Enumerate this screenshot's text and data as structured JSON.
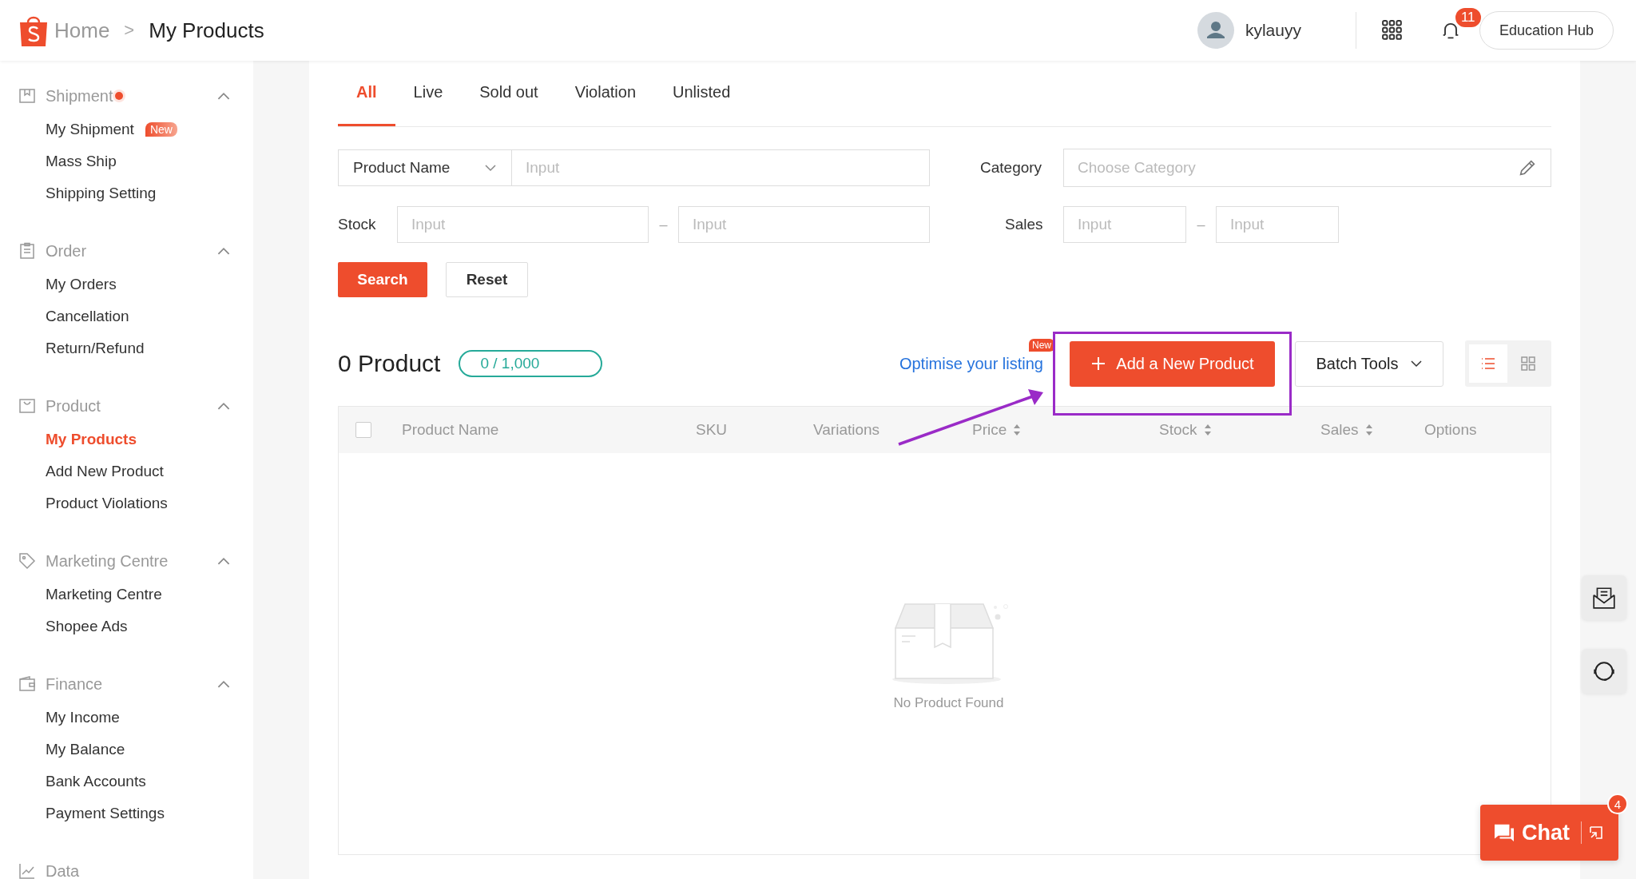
{
  "header": {
    "breadcrumb": [
      {
        "label": "Home"
      }
    ],
    "separator": ">",
    "current": "My Products",
    "user": "kylauyy",
    "notification_count": "11",
    "button": "Education Hub"
  },
  "sidebar": {
    "sections": [
      {
        "kind": "shipment",
        "title": "Shipment",
        "dot": true,
        "expanded": true,
        "items": [
          {
            "label": "My Shipment",
            "selected": false,
            "badge": "New"
          },
          {
            "label": "Mass Ship",
            "selected": false
          },
          {
            "label": "Shipping Setting",
            "selected": false
          }
        ]
      },
      {
        "kind": "order",
        "title": "Order",
        "expanded": true,
        "items": [
          {
            "label": "My Orders",
            "selected": false
          },
          {
            "label": "Cancellation",
            "selected": false
          },
          {
            "label": "Return/Refund",
            "selected": false
          }
        ]
      },
      {
        "kind": "product",
        "title": "Product",
        "expanded": true,
        "items": [
          {
            "label": "My Products",
            "selected": true
          },
          {
            "label": "Add New Product",
            "selected": false
          },
          {
            "label": "Product Violations",
            "selected": false
          }
        ]
      },
      {
        "kind": "marketing",
        "title": "Marketing Centre",
        "expanded": true,
        "items": [
          {
            "label": "Marketing Centre",
            "selected": false
          },
          {
            "label": "Shopee Ads",
            "selected": false
          }
        ]
      },
      {
        "kind": "finance",
        "title": "Finance",
        "expanded": true,
        "items": [
          {
            "label": "My Income",
            "selected": false
          },
          {
            "label": "My Balance",
            "selected": false
          },
          {
            "label": "Bank Accounts",
            "selected": false
          },
          {
            "label": "Payment Settings",
            "selected": false
          }
        ]
      },
      {
        "kind": "data",
        "title": "Data"
      }
    ]
  },
  "tabs": [
    {
      "label": "All",
      "selected": true
    },
    {
      "label": "Live",
      "selected": false
    },
    {
      "label": "Sold out",
      "selected": false
    },
    {
      "label": "Violation",
      "selected": false
    },
    {
      "label": "Unlisted",
      "selected": false
    }
  ],
  "filters": {
    "field_select": "Product Name",
    "field_input": {
      "placeholder": "Input"
    },
    "category": {
      "label": "Category",
      "placeholder": "Choose Category"
    },
    "stock": {
      "label": "Stock",
      "min": {
        "placeholder": "Input"
      },
      "separator": "–",
      "max": {
        "placeholder": "Input"
      }
    },
    "sales": {
      "label": "Sales",
      "min": {
        "placeholder": "Input"
      },
      "separator": "–",
      "max": {
        "placeholder": "Input"
      }
    },
    "search_button": "Search",
    "reset_button": "Reset"
  },
  "summary": {
    "count": "0 Product",
    "quota": "0 / 1,000",
    "link": "Optimise your listing",
    "link_badge": "New",
    "add_button": "Add a New Product",
    "batch_button": "Batch Tools",
    "views": [
      {
        "kind": "list",
        "selected": true
      },
      {
        "kind": "grid",
        "selected": false
      }
    ]
  },
  "table": {
    "select_all": {
      "checked": false
    },
    "columns": [
      {
        "label": "Product Name",
        "sortable": false
      },
      {
        "label": "SKU",
        "sortable": false
      },
      {
        "label": "Variations",
        "sortable": false
      },
      {
        "label": "Price",
        "sortable": true
      },
      {
        "label": "Stock",
        "sortable": true
      },
      {
        "label": "Sales",
        "sortable": true
      },
      {
        "label": "Options",
        "sortable": false
      }
    ],
    "empty_text": "No Product Found"
  },
  "chat": {
    "label": "Chat",
    "badge": "4"
  }
}
